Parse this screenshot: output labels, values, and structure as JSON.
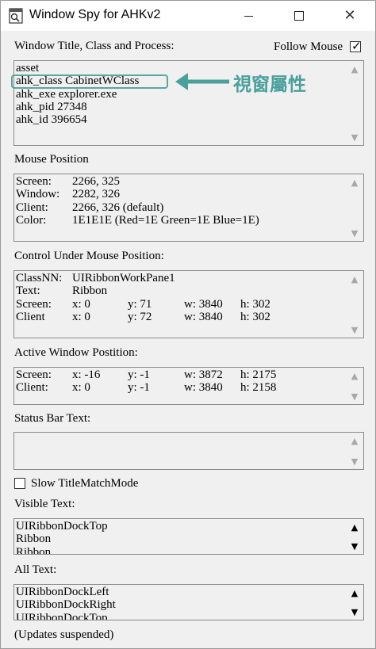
{
  "window": {
    "title": "Window Spy for AHKv2",
    "icon": "window-spy-icon",
    "buttons": {
      "minimize": "minimize-icon",
      "maximize": "maximize-icon",
      "close": "✕"
    }
  },
  "title_section": {
    "label": "Window Title, Class and Process:",
    "follow_mouse_label": "Follow Mouse",
    "follow_mouse_checked": true,
    "checkmark": "✓",
    "lines": [
      "asset",
      "ahk_class CabinetWClass",
      "ahk_exe explorer.exe",
      "ahk_pid 27348",
      "ahk_id 396654"
    ],
    "annotation": "視窗屬性",
    "annotation_color": "#4aa09d"
  },
  "mouse_section": {
    "label": "Mouse Position",
    "rows": [
      [
        "Screen:",
        "2266, 325"
      ],
      [
        "Window:",
        "2282, 326"
      ],
      [
        "Client:",
        "2266, 326 (default)"
      ],
      [
        "Color:",
        "1E1E1E (Red=1E Green=1E Blue=1E)"
      ]
    ]
  },
  "control_section": {
    "label": "Control Under Mouse Position:",
    "rows": [
      [
        "ClassNN:",
        "UIRibbonWorkPane1"
      ],
      [
        "Text:",
        "Ribbon"
      ],
      [
        "Screen:",
        "x: 0",
        "y: 71",
        "w: 3840",
        "h: 302"
      ],
      [
        "Client",
        "x: 0",
        "y: 72",
        "w: 3840",
        "h: 302"
      ]
    ]
  },
  "active_section": {
    "label": "Active Window Postition:",
    "rows": [
      [
        "Screen:",
        "x: -16",
        "y: -1",
        "w: 3872",
        "h: 2175"
      ],
      [
        "Client:",
        "x: 0",
        "y: -1",
        "w: 3840",
        "h: 2158"
      ]
    ]
  },
  "statusbar_section": {
    "label": "Status Bar Text:"
  },
  "slow_mode": {
    "label": "Slow TitleMatchMode",
    "checked": false
  },
  "visible_text": {
    "label": "Visible Text:",
    "lines": [
      "UIRibbonDockTop",
      "Ribbon",
      "Ribbon"
    ]
  },
  "all_text": {
    "label": "All Text:",
    "lines": [
      "UIRibbonDockLeft",
      "UIRibbonDockRight",
      "UIRibbonDockTop"
    ]
  },
  "status": "(Updates suspended)"
}
